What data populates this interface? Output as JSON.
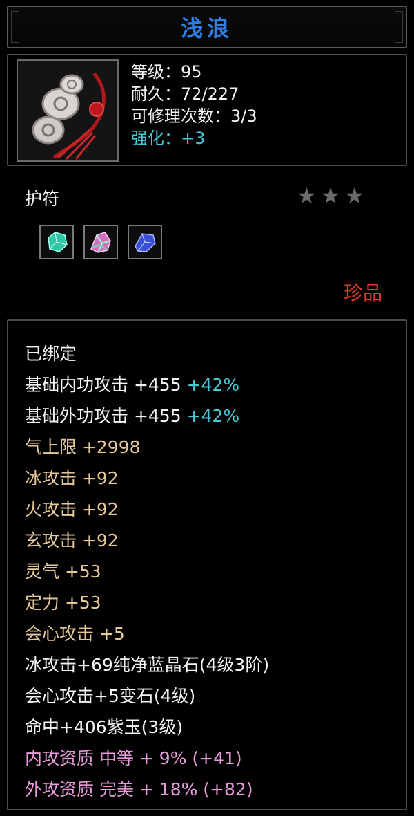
{
  "item": {
    "name": "浅浪",
    "level": "等级：95",
    "durability": "耐久：72/227",
    "repairs": "可修理次数：3/3",
    "enhance": "强化：+3",
    "type": "护符",
    "rarity": "珍品",
    "stars": 3,
    "icon_name": "amulet-pendant-icon",
    "gems": [
      {
        "name": "green-crystal-gem-icon",
        "color": "#2fc7a6"
      },
      {
        "name": "multicolor-crystal-gem-icon",
        "color": "#d070c0"
      },
      {
        "name": "blue-crystal-gem-icon",
        "color": "#3a4fd8"
      }
    ]
  },
  "attributes": {
    "bound": "已绑定",
    "inner_attack_label": "基础内功攻击  +455",
    "inner_attack_pct": "+42%",
    "outer_attack_label": "基础外功攻击  +455",
    "outer_attack_pct": "+42%",
    "qi": "气上限  +2998",
    "ice": "冰攻击  +92",
    "fire": "火攻击  +92",
    "mystic": "玄攻击  +92",
    "spirit": "灵气  +53",
    "focus": "定力  +53",
    "crit": "会心攻击  +5",
    "gem1": "冰攻击+69纯净蓝晶石(4级3阶)",
    "gem2": "会心攻击+5变石(4级)",
    "gem3": "命中+406紫玉(3级)",
    "inner_quality": "内攻资质  中等  +  9% (+41)",
    "outer_quality": "外攻资质  完美  +  18% (+82)"
  },
  "colors": {
    "title": "#2e7fe6",
    "enhance": "#46c8d6",
    "rarity": "#e03a28",
    "gold_attr": "#e6c898",
    "pink_attr": "#e89bdb"
  }
}
